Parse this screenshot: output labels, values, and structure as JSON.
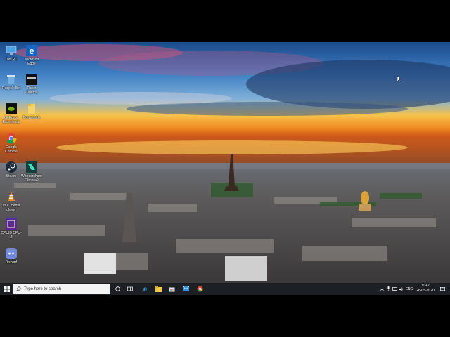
{
  "desktop": {
    "icons": [
      {
        "label": "This PC",
        "icon": "this-pc-icon"
      },
      {
        "label": "Microsoft Edge",
        "icon": "edge-icon"
      },
      {
        "label": "Recycle Bin",
        "icon": "recycle-bin-icon"
      },
      {
        "label": "Ticket Cinema",
        "icon": "app-icon"
      },
      {
        "label": "GeForce Experience",
        "icon": "nvidia-icon"
      },
      {
        "label": "Downloads",
        "icon": "folder-icon"
      },
      {
        "label": "Google Chrome",
        "icon": "chrome-icon"
      },
      {
        "label": "Steam",
        "icon": "steam-icon"
      },
      {
        "label": "Wondershare Filmora9",
        "icon": "filmora-icon"
      },
      {
        "label": "VLC media player",
        "icon": "vlc-icon"
      },
      {
        "label": "CPUID CPU-Z",
        "icon": "cpuz-icon"
      },
      {
        "label": "Discord",
        "icon": "discord-icon"
      }
    ]
  },
  "taskbar": {
    "search_placeholder": "Type here to search",
    "language": "ENG",
    "time": "11:47",
    "date": "28-05-2020"
  },
  "colors": {
    "taskbar_bg": "#1c1f24",
    "accent": "#0078d7"
  }
}
